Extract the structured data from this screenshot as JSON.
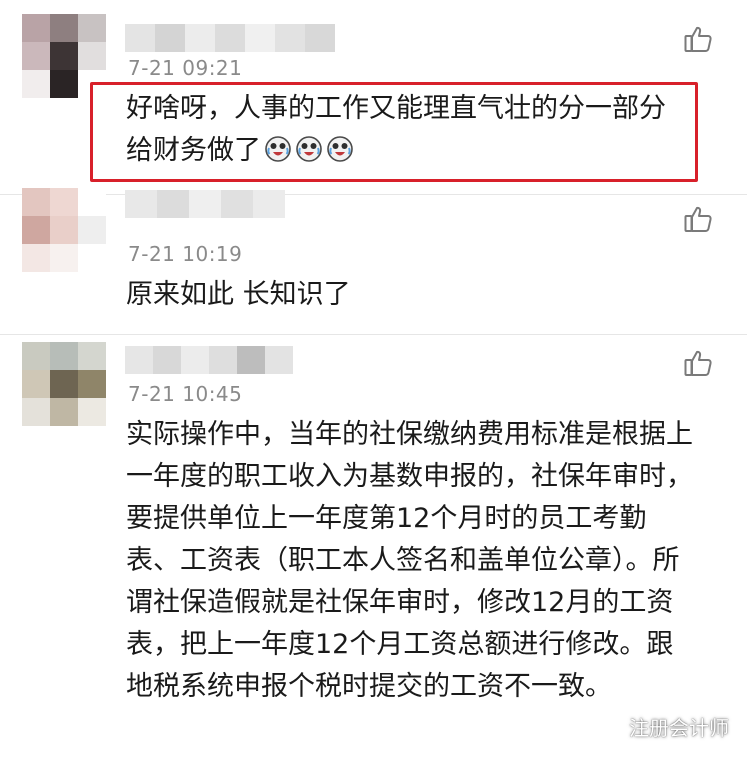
{
  "comments": [
    {
      "timestamp": "7-21 09:21",
      "text_line1": "好啥呀，人事的工作又能理直气壮的分一部分",
      "text_line2": "给财务做了"
    },
    {
      "timestamp": "7-21 10:19",
      "text": "原来如此 长知识了"
    },
    {
      "timestamp": "7-21 10:45",
      "text": "实际操作中，当年的社保缴纳费用标准是根据上一年度的职工收入为基数申报的，社保年审时，要提供单位上一年度第12个月时的员工考勤表、工资表（职工本人签名和盖单位公章）。所谓社保造假就是社保年审时，修改12月的工资表，把上一年度12个月工资总额进行修改。跟地税系统申报个税时提交的工资不一致。"
    }
  ],
  "watermark": {
    "label": "注册会计师"
  },
  "colors": {
    "highlight_border": "#d8202a",
    "timestamp": "#8a8a8a",
    "text": "#1a1a1a"
  },
  "icons": {
    "like": "thumbs-up-icon",
    "emoji": "crying-laughing-emoji",
    "watermark": "wechat-official-account-icon"
  }
}
